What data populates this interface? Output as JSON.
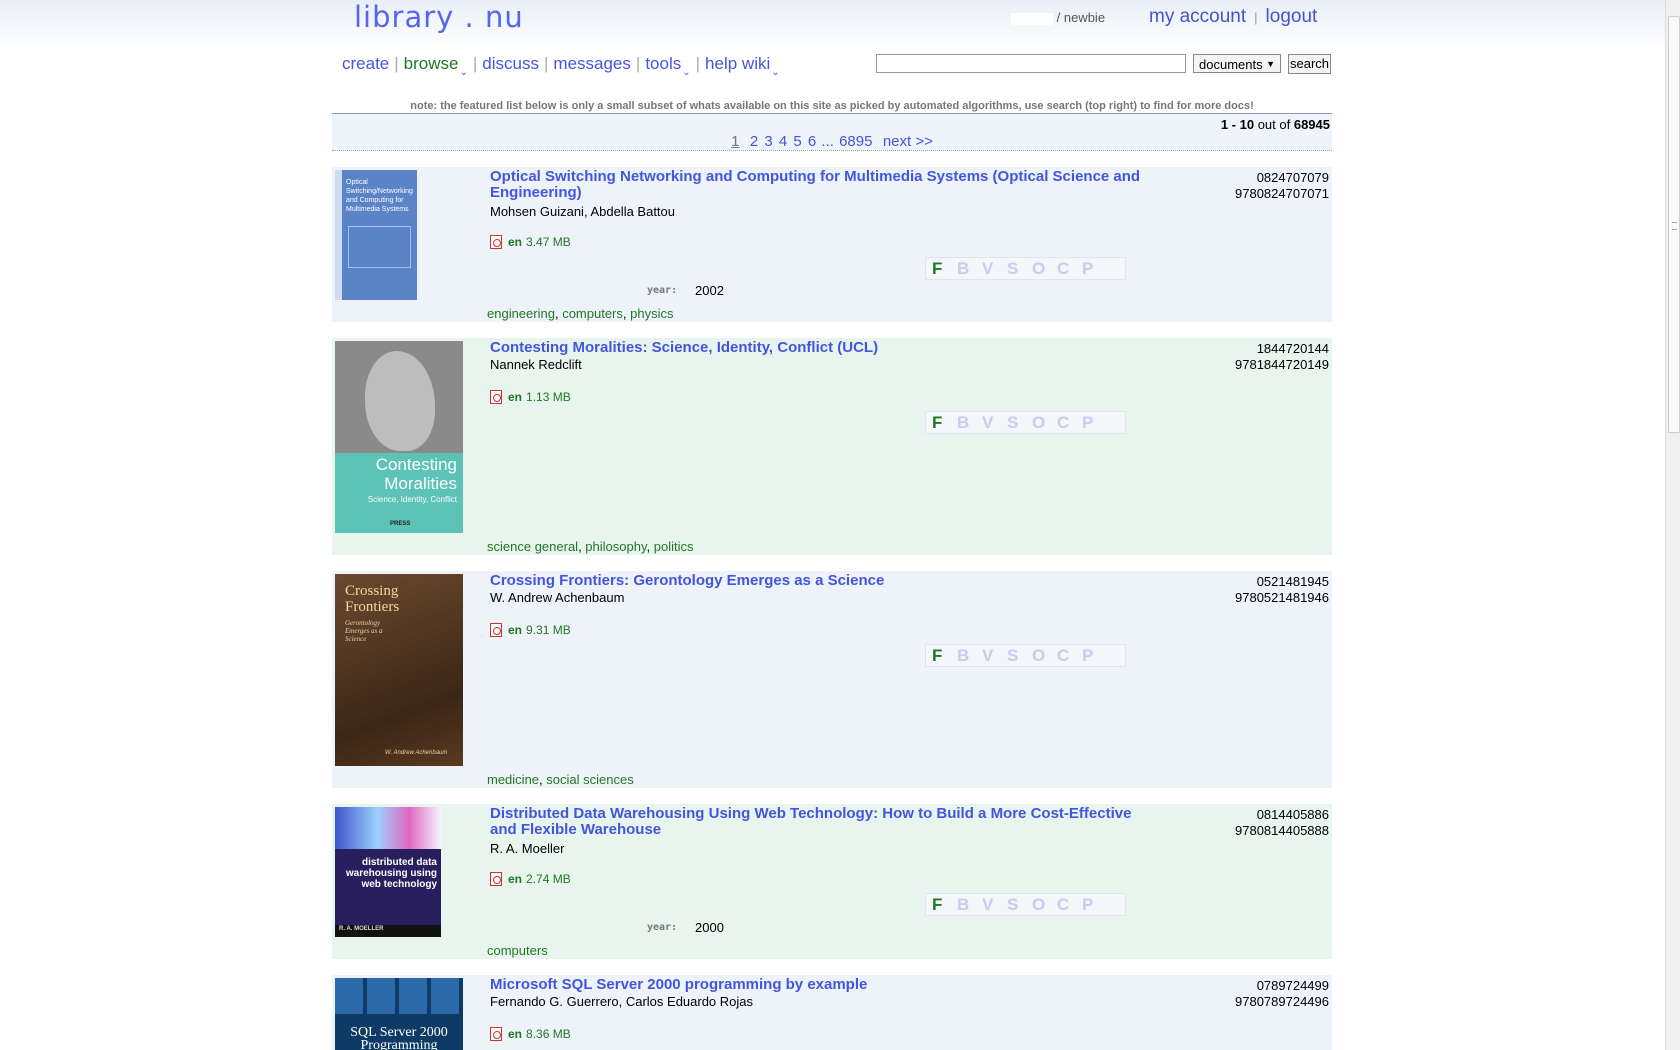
{
  "header": {
    "logo": "library . nu",
    "user_rank": "/ newbie",
    "my_account": "my account",
    "separator": "|",
    "logout": "logout"
  },
  "nav": {
    "items": [
      {
        "label": "create"
      },
      {
        "label": "browse"
      },
      {
        "label": "discuss"
      },
      {
        "label": "messages"
      },
      {
        "label": "tools"
      },
      {
        "label": "help wiki"
      }
    ],
    "separator": "|"
  },
  "search": {
    "value": "",
    "type_selected": "documents",
    "button": "search"
  },
  "note": "note: the featured list below is only a small subset of whats available on this site as picked by automated algorithms, use search (top right) to find for more docs!",
  "results": {
    "range": "1 - 10",
    "out_of": "out of",
    "total": "68945"
  },
  "pager": {
    "pages": [
      "1",
      "2",
      "3",
      "4",
      "5",
      "6"
    ],
    "ellipsis": "...",
    "last": "6895",
    "next": "next >>"
  },
  "format_letters": [
    "F",
    "B",
    "V",
    "S",
    "O",
    "C",
    "P"
  ],
  "year_label": "year:",
  "entries": [
    {
      "title": "Optical Switching Networking and Computing for Multimedia Systems (Optical Science and Engineering)",
      "authors": "Mohsen Guizani, Abdella Battou",
      "lang": "en",
      "size": "3.47 MB",
      "isbn10": "0824707079",
      "isbn13": "9780824707071",
      "year": "2002",
      "tags": [
        "engineering",
        "computers",
        "physics"
      ],
      "cover_text": "Optical Switching/Networking and Computing for Multimedia Systems"
    },
    {
      "title": "Contesting Moralities: Science, Identity, Conflict (UCL)",
      "authors": "Nannek Redclift",
      "lang": "en",
      "size": "1.13 MB",
      "isbn10": "1844720144",
      "isbn13": "9781844720149",
      "tags": [
        "science general",
        "philosophy",
        "politics"
      ],
      "cover_title_1": "Contesting",
      "cover_title_2": "Moralities",
      "cover_sub": "Science, Identity, Conflict",
      "cover_publisher": "PRESS"
    },
    {
      "title": "Crossing Frontiers: Gerontology Emerges as a Science",
      "authors": "W. Andrew Achenbaum",
      "lang": "en",
      "size": "9.31 MB",
      "isbn10": "0521481945",
      "isbn13": "9780521481946",
      "tags": [
        "medicine",
        "social sciences"
      ],
      "cover_title_1": "Crossing",
      "cover_title_2": "Frontiers",
      "cover_sub": "Gerontology Emerges as a Science",
      "cover_author": "W. Andrew Achenbaum"
    },
    {
      "title": "Distributed Data Warehousing Using Web Technology: How to Build a More Cost-Effective and Flexible Warehouse",
      "authors": "R. A. Moeller",
      "lang": "en",
      "size": "2.74 MB",
      "isbn10": "0814405886",
      "isbn13": "9780814405888",
      "year": "2000",
      "tags": [
        "computers"
      ],
      "cover_title": "distributed data warehousing using web technology",
      "cover_author": "R. A. MOELLER"
    },
    {
      "title": "Microsoft SQL Server 2000 programming by example",
      "authors": "Fernando G. Guerrero, Carlos Eduardo Rojas",
      "lang": "en",
      "size": "8.36 MB",
      "isbn10": "0789724499",
      "isbn13": "9780789724496",
      "cover_text": "SQL Server 2000 Programming"
    }
  ]
}
